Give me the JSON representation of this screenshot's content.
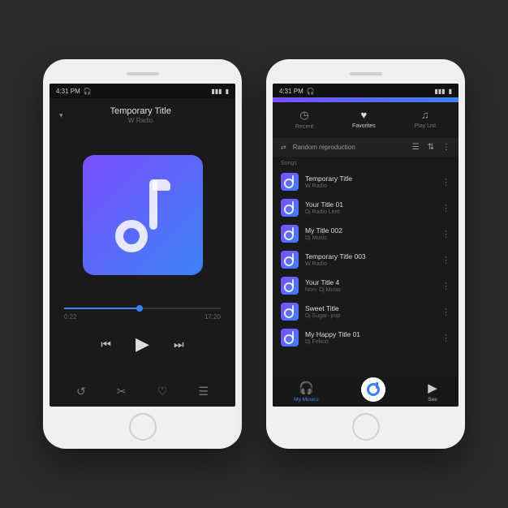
{
  "status": {
    "time": "4:31 PM",
    "headphone": "🎧",
    "signal": "▮▮▮",
    "wifi": "📶",
    "battery": "▮"
  },
  "player": {
    "title": "Temporary Title",
    "subtitle": "W Radio",
    "time_elapsed": "0:22",
    "time_total": "17:20"
  },
  "playlist": {
    "tabs": {
      "recent": "Recent",
      "favorites": "Favorites",
      "playlist": "Play List"
    },
    "shuffle_label": "Random reproduction",
    "section_label": "Songs",
    "songs": [
      {
        "title": "Temporary Title",
        "artist": "W Radio"
      },
      {
        "title": "Your Title 01",
        "artist": "Dj Radio Lent"
      },
      {
        "title": "My Title 002",
        "artist": "Dj Music"
      },
      {
        "title": "Temporary Title 003",
        "artist": "W Radio"
      },
      {
        "title": "Your Title 4",
        "artist": "Non- Dj Music"
      },
      {
        "title": "Sweet Title",
        "artist": "Dj Sugar- pop"
      },
      {
        "title": "My Happy Title 01",
        "artist": "Dj Felicio"
      }
    ],
    "bottom_nav": {
      "music": "My Musics",
      "see": "See"
    }
  }
}
